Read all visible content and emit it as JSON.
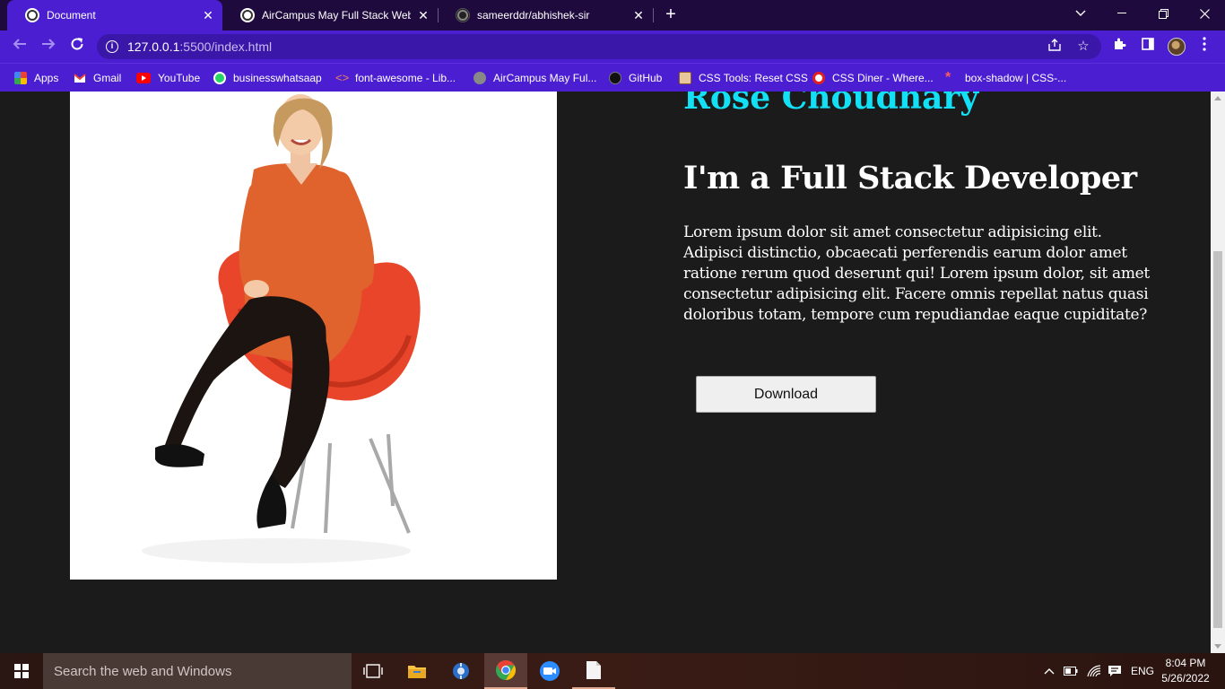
{
  "browser": {
    "tabs": [
      {
        "title": "Document",
        "active": true
      },
      {
        "title": "AirCampus May Full Stack Web D",
        "active": false
      },
      {
        "title": "sameerddr/abhishek-sir",
        "active": false
      }
    ],
    "address": {
      "host": "127.0.0.1",
      "path": ":5500/index.html"
    },
    "bookmarks": [
      {
        "label": "Apps",
        "icon": "apps-grid-icon"
      },
      {
        "label": "Gmail",
        "icon": "gmail-icon"
      },
      {
        "label": "YouTube",
        "icon": "youtube-icon"
      },
      {
        "label": "businesswhatsaap",
        "icon": "whatsapp-icon"
      },
      {
        "label": "font-awesome - Lib...",
        "icon": "code-icon"
      },
      {
        "label": "AirCampus May Ful...",
        "icon": "globe-icon"
      },
      {
        "label": "GitHub",
        "icon": "github-icon"
      },
      {
        "label": "CSS Tools: Reset CSS",
        "icon": "css-tools-icon"
      },
      {
        "label": "CSS Diner - Where...",
        "icon": "css-diner-icon"
      },
      {
        "label": "box-shadow | CSS-...",
        "icon": "asterisk-icon"
      }
    ]
  },
  "page": {
    "name": "Rose Choudhary",
    "role": "I'm a Full Stack Developer",
    "about": "Lorem ipsum dolor sit amet consectetur adipisicing elit. Adipisci distinctio, obcaecati perferendis earum dolor amet ratione rerum quod deserunt qui! Lorem ipsum dolor, sit amet consectetur adipisicing elit. Facere omnis repellat natus quasi doloribus totam, tempore cum repudiandae eaque cupiditate?",
    "download_label": "Download"
  },
  "taskbar": {
    "search_placeholder": "Search the web and Windows",
    "language": "ENG",
    "time": "8:04 PM",
    "date": "5/26/2022"
  },
  "colors": {
    "browser_accent": "#4b1fd1",
    "tabstrip": "#1f0a3d",
    "page_bg": "#1b1b1b",
    "name_color": "#13e0f5"
  }
}
